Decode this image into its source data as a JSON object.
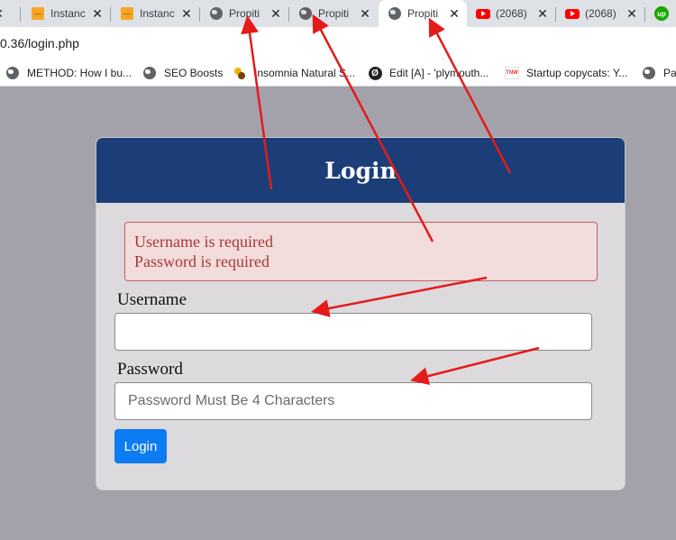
{
  "tabs": [
    {
      "title": "",
      "favicon": "close-icon"
    },
    {
      "title": "Instanc",
      "favicon": "package-icon"
    },
    {
      "title": "Instanc",
      "favicon": "package-icon"
    },
    {
      "title": "Propiti",
      "favicon": "globe-icon"
    },
    {
      "title": "Propiti",
      "favicon": "globe-icon"
    },
    {
      "title": "Propiti",
      "favicon": "globe-icon",
      "active": true
    },
    {
      "title": "(2068)",
      "favicon": "youtube-icon"
    },
    {
      "title": "(2068)",
      "favicon": "youtube-icon"
    },
    {
      "title": "",
      "favicon": "upwork-icon",
      "text": "up"
    }
  ],
  "tab_close_glyph": "✕",
  "address": {
    "url": "0.36/login.php"
  },
  "bookmarks": [
    {
      "label": "METHOD: How I bu...",
      "icon": "globe-icon"
    },
    {
      "label": "SEO Boosts",
      "icon": "globe-icon"
    },
    {
      "label": "Insomnia Natural S...",
      "icon": "bee-icon"
    },
    {
      "label": "Edit [A] - 'plymouth...",
      "icon": "edit-icon",
      "text": "Ø"
    },
    {
      "label": "Startup copycats: Y...",
      "icon": "tnw-icon",
      "text": "TNW"
    },
    {
      "label": "Par",
      "icon": "globe-icon"
    }
  ],
  "login": {
    "title": "Login",
    "errors": [
      "Username is required",
      "Password is required"
    ],
    "username_label": "Username",
    "username_value": "",
    "username_placeholder": "",
    "password_label": "Password",
    "password_value": "",
    "password_placeholder": "Password Must Be 4 Characters",
    "button_label": "Login"
  },
  "colors": {
    "header": "#1b3e78",
    "alert_bg": "#f3dcdc",
    "alert_text": "#a53a36",
    "button": "#0d7cf2",
    "annotation_arrow": "#e41b1b",
    "page_background": "#a3a2ab"
  }
}
